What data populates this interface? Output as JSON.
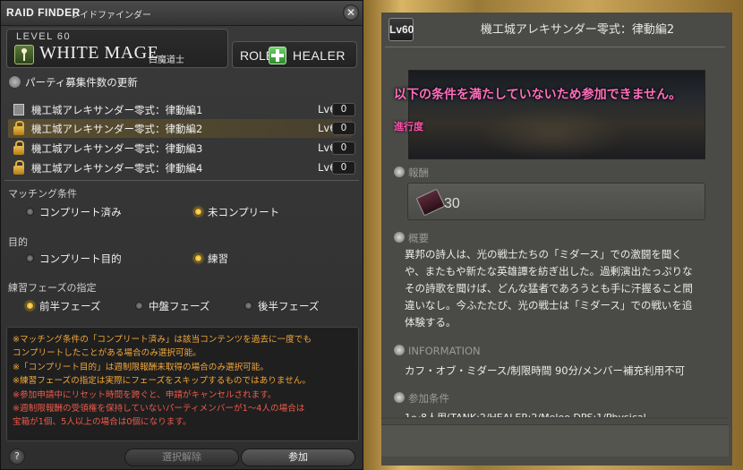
{
  "window": {
    "title_en": "RAID FINDER",
    "title_jp": "レイドファインダー",
    "close_icon": "gear-close-icon"
  },
  "job": {
    "level": "LEVEL 60",
    "name": "WHITE MAGE",
    "name_jp": "白魔道士"
  },
  "role": {
    "label": "ROLE",
    "name": "HEALER"
  },
  "refresh": {
    "label": "パーティ募集件数の更新"
  },
  "duties": [
    {
      "name": "機工城アレキサンダー零式：律動編1",
      "level": "Lv60",
      "count": "0",
      "icon": "checkbox"
    },
    {
      "name": "機工城アレキサンダー零式：律動編2",
      "level": "Lv60",
      "count": "0",
      "icon": "lock",
      "selected": true
    },
    {
      "name": "機工城アレキサンダー零式：律動編3",
      "level": "Lv60",
      "count": "0",
      "icon": "lock"
    },
    {
      "name": "機工城アレキサンダー零式：律動編4",
      "level": "Lv60",
      "count": "0",
      "icon": "lock"
    }
  ],
  "matching": {
    "label": "マッチング条件",
    "opt1": "コンプリート済み",
    "opt2": "未コンプリート",
    "selected": "opt2"
  },
  "purpose": {
    "label": "目的",
    "opt1": "コンプリート目的",
    "opt2": "練習",
    "selected": "opt2"
  },
  "phase": {
    "label": "練習フェーズの指定",
    "opt1": "前半フェーズ",
    "opt2": "中盤フェーズ",
    "opt3": "後半フェーズ",
    "selected": "opt1"
  },
  "notes": {
    "n1": "※マッチング条件の「コンプリート済み」は該当コンテンツを過去に一度でも",
    "n2": "コンプリートしたことがある場合のみ選択可能。",
    "n3": "※「コンプリート目的」は週制限報酬未取得の場合のみ選択可能。",
    "n4": "※練習フェーズの指定は実際にフェーズをスキップするものではありません。",
    "n5": "※参加申請中にリセット時間を跨ぐと、申請がキャンセルされます。",
    "n6": "※週制限報酬の受領権を保持していないパーティメンバーが1～4人の場合は",
    "n7": "宝箱が1個、5人以上の場合は0個になります。"
  },
  "footer": {
    "help": "?",
    "clear": "選択解除",
    "join": "参加"
  },
  "detail": {
    "level": "Lv60",
    "title": "機工城アレキサンダー零式：律動編2",
    "warning": "以下の条件を満たしていないため参加できません。",
    "progress_label": "進行度",
    "reward_heading": "報酬",
    "reward_count": "30",
    "overview_heading": "概要",
    "desc1": "異邦の詩人は、光の戦士たちの「ミダース」での激闘を聞く",
    "desc2": "や、またもや新たな英雄譚を紡ぎ出した。過剰演出たっぷりな",
    "desc3": "その詩歌を聞けば、どんな猛者であろうとも手に汗握ること間",
    "desc4": "違いなし。今ふたたび、光の戦士は「ミダース」での戦いを追",
    "desc5": "体験する。",
    "info_heading": "INFORMATION",
    "info_text": "カフ・オブ・ミダース/制限時間 90分/メンバー補充利用不可",
    "cond_heading": "参加条件",
    "cond_text": "1～8人用(TANK:2/HEALER:2/Melee DPS:1/Physical"
  }
}
